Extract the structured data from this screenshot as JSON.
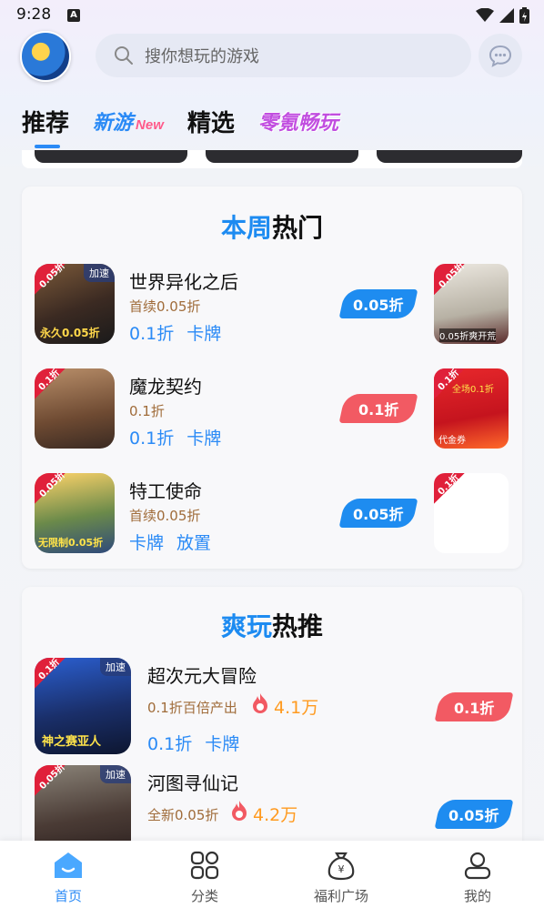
{
  "status_bar": {
    "time": "9:28"
  },
  "search": {
    "placeholder": "搜你想玩的游戏"
  },
  "tabs": [
    {
      "label": "推荐"
    },
    {
      "label": "新游",
      "tag": "New"
    },
    {
      "label": "精选"
    },
    {
      "label": "零氪畅玩"
    }
  ],
  "weekly_hot": {
    "title_highlight": "本周",
    "title_rest": "热门",
    "games": [
      {
        "name": "世界异化之后",
        "sub": "首续0.05折",
        "tags": [
          "0.1折",
          "卡牌"
        ],
        "badge": "0.05折",
        "badge_color": "#1e8cf0",
        "icon_corner": "0.05折",
        "icon_speed": "加速",
        "icon_caption": "永久0.05折"
      },
      {
        "name": "魔龙契约",
        "sub": "0.1折",
        "tags": [
          "0.1折",
          "卡牌"
        ],
        "badge": "0.1折",
        "badge_color": "#f25a63",
        "icon_corner": "0.1折"
      },
      {
        "name": "特工使命",
        "sub": "首续0.05折",
        "tags": [
          "卡牌",
          "放置"
        ],
        "badge": "0.05折",
        "badge_color": "#1e8cf0",
        "icon_corner": "0.05折",
        "icon_caption": "无限制0.05折"
      }
    ],
    "side_images": [
      {
        "corner": "0.05折",
        "caption": "0.05折爽开荒"
      },
      {
        "corner": "0.1折",
        "caption": "全场0.1折",
        "sub_caption": "代金券"
      },
      {
        "corner": "0.1折"
      }
    ]
  },
  "cool_hot": {
    "title_highlight": "爽玩",
    "title_rest": "热推",
    "games": [
      {
        "name": "超次元大冒险",
        "sub": "0.1折百倍产出",
        "hot": "4.1万",
        "tags": [
          "0.1折",
          "卡牌"
        ],
        "badge": "0.1折",
        "badge_color": "#f25a63",
        "icon_corner": "0.1折",
        "icon_speed": "加速",
        "icon_caption": "神之赛亚人"
      },
      {
        "name": "河图寻仙记",
        "sub": "全新0.05折",
        "hot": "4.2万",
        "badge": "0.05折",
        "badge_color": "#1e8cf0",
        "icon_corner": "0.05折",
        "icon_speed": "加速"
      }
    ]
  },
  "bottom_nav": [
    {
      "label": "首页",
      "active": true
    },
    {
      "label": "分类"
    },
    {
      "label": "福利广场"
    },
    {
      "label": "我的"
    }
  ],
  "colors": {
    "accent": "#2a8af6",
    "red_badge": "#f25a63",
    "blue_badge": "#1e8cf0"
  }
}
